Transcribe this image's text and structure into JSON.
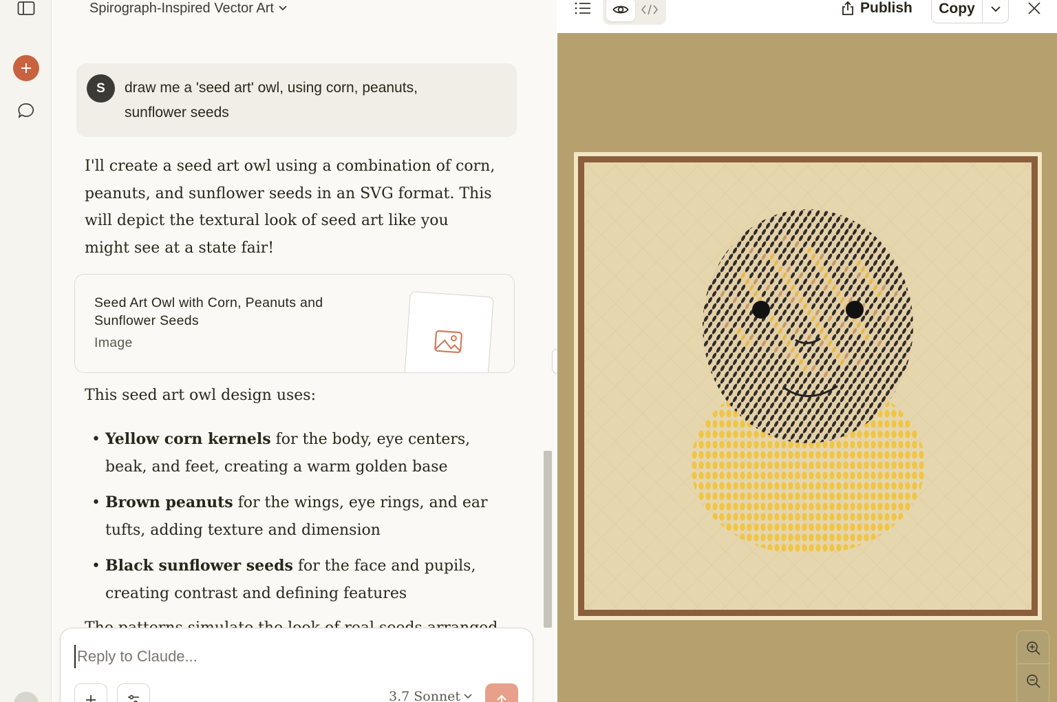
{
  "sidebar": {
    "new_chat_icon": "plus-icon",
    "panel_toggle_icon": "sidebar-toggle-icon",
    "chats_icon": "chat-bubble-icon",
    "accent": "#c9623f"
  },
  "chat": {
    "title": "Spirograph-Inspired Vector Art",
    "user_initial": "S",
    "user_message": "draw me a 'seed art' owl, using corn, peanuts, sunflower seeds",
    "reply_intro": "I'll create a seed art owl using a combination of corn, peanuts, and sunflower seeds in an SVG format. This will depict the textural look of seed art like you might see at a state fair!",
    "artifact": {
      "title": "Seed Art Owl with Corn, Peanuts and Sunflower Seeds",
      "type": "Image"
    },
    "uses_heading": "This seed art owl design uses:",
    "bullets": [
      {
        "bold": "Yellow corn kernels",
        "rest": " for the body, eye centers, beak, and feet, creating a warm golden base"
      },
      {
        "bold": "Brown peanuts",
        "rest": " for the wings, eye rings, and ear tufts, adding texture and dimension"
      },
      {
        "bold": "Black sunflower seeds",
        "rest": " for the face and pupils, creating contrast and defining features"
      }
    ],
    "cut_off_line": "The patterns simulate the look of real seeds arranged"
  },
  "composer": {
    "placeholder": "Reply to Claude...",
    "model": "3.7 Sonnet"
  },
  "artifact_panel": {
    "publish_label": "Publish",
    "copy_label": "Copy",
    "background": "#b5a06e",
    "frame_color": "#8b5e3c",
    "canvas_color": "#e6d6ae"
  }
}
